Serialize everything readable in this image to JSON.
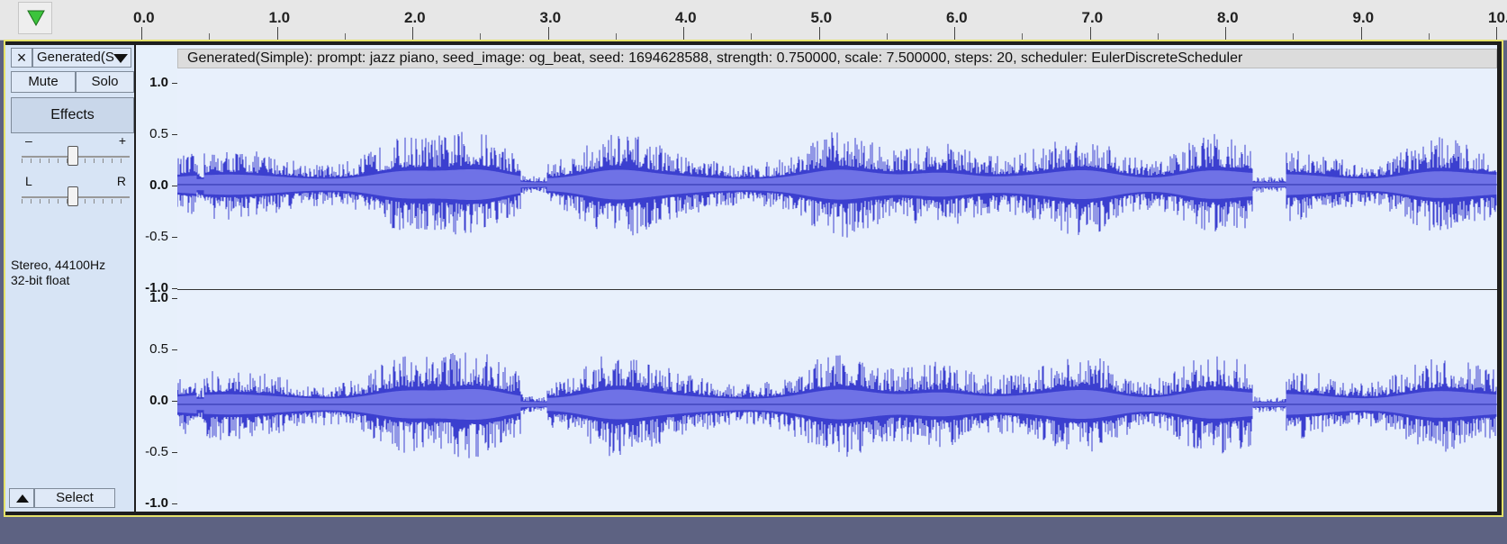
{
  "ruler": {
    "ticks": [
      "0.0",
      "1.0",
      "2.0",
      "3.0",
      "4.0",
      "5.0",
      "6.0",
      "7.0",
      "8.0",
      "9.0",
      "10."
    ]
  },
  "track": {
    "close_label": "×",
    "name": "Generated(S",
    "mute_label": "Mute",
    "solo_label": "Solo",
    "effects_label": "Effects",
    "gain_minus": "–",
    "gain_plus": "+",
    "pan_left": "L",
    "pan_right": "R",
    "format_line1": "Stereo, 44100Hz",
    "format_line2": "32-bit float",
    "select_label": "Select"
  },
  "clip": {
    "title": "Generated(Simple): prompt: jazz piano, seed_image: og_beat, seed: 1694628588, strength: 0.750000, scale: 7.500000, steps: 20, scheduler: EulerDiscreteScheduler"
  },
  "vscale": {
    "top": [
      "1.0",
      "0.5",
      "0.0",
      "-0.5",
      "-1.0"
    ],
    "bottom": [
      "1.0",
      "0.5",
      "0.0",
      "-0.5",
      "-1.0"
    ]
  },
  "colors": {
    "waveform": "#3b3fcf",
    "waveform_rms": "#6f72e6",
    "selection_border": "#e5e26a"
  }
}
